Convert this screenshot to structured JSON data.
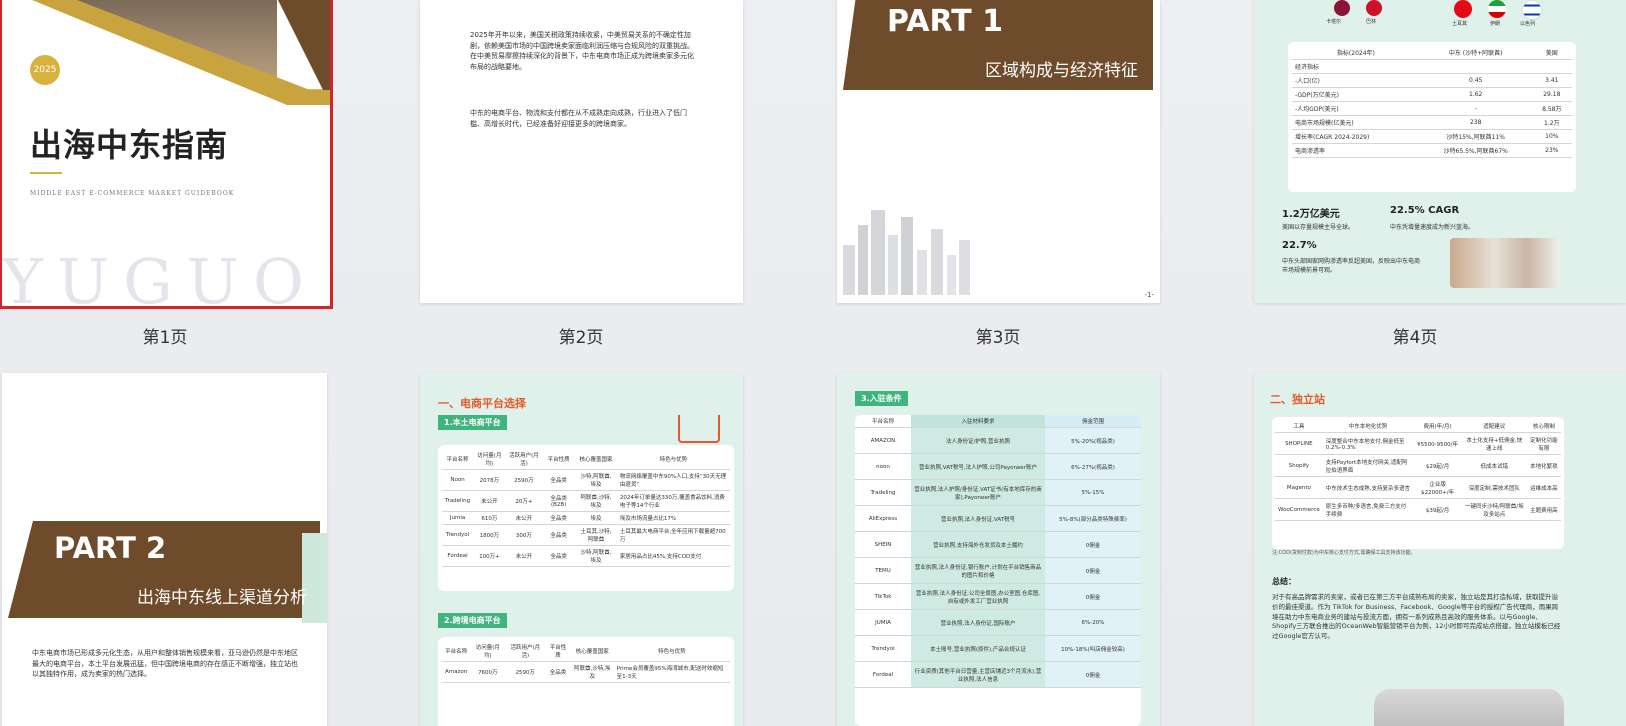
{
  "pages": [
    {
      "label": "第1页"
    },
    {
      "label": "第2页"
    },
    {
      "label": "第3页"
    },
    {
      "label": "第4页"
    }
  ],
  "p1": {
    "year": "2025",
    "title": "出海中东指南",
    "subtitle": "MIDDLE EAST E-COMMERCE MARKET GUIDEBOOK",
    "watermark": "YUGUO"
  },
  "p2": {
    "para1": "2025年开年以来，美国关税政策持续收紧，中美贸易关系的不确定性加剧，依赖美国市场的中国跨境卖家面临利润压缩与合规风险的双重挑战。在中美贸易摩擦持续深化的背景下，中东电商市场正成为跨境卖家多元化布局的战略要地。",
    "para2": "中东的电商平台、物流和支付都在从不成熟走向成熟，行业进入了低门槛、高增长时代，已经准备好迎接更多的跨境商家。"
  },
  "p3": {
    "part": "PART 1",
    "title": "区域构成与经济特征",
    "page_no": "-1-"
  },
  "p4": {
    "head": [
      "指标(2024年)",
      "中东 (沙特+阿联酋)",
      "美国"
    ],
    "rows": [
      [
        "经济指标",
        "",
        ""
      ],
      [
        "-人口(亿)",
        "0.45",
        "3.41"
      ],
      [
        "-GDP(万亿美元)",
        "1.62",
        "29.18"
      ],
      [
        "-人均GDP(美元)",
        "-",
        "8.58万"
      ],
      [
        "电商市场规模(亿美元)",
        "238",
        "1.2万"
      ],
      [
        "增长率(CAGR 2024-2029)",
        "沙特15%,阿联酋11%",
        "10%"
      ],
      [
        "电商渗透率",
        "沙特65.5%,阿联酋67%",
        "23%"
      ]
    ],
    "flags": [
      "卡塔尔",
      "巴林",
      "土耳其",
      "伊朗",
      "以色列"
    ],
    "stat1": "1.2万亿美元",
    "stat1_desc": "美国以存量规模主导全球。",
    "stat2": "22.5% CAGR",
    "stat2_desc": "中东凭增量速度成为新兴蓝海。",
    "stat3": "22.7%",
    "stat3_desc": "中东头部国家网购渗透率反超美国，反映出中东电商市场规模前景可观。"
  },
  "p5": {
    "part": "PART 2",
    "title": "出海中东线上渠道分析",
    "body": "中东电商市场已形成多元化生态，从用户和整体销售规模来看，亚马逊仍然是中东地区最大的电商平台，本土平台发展迅猛，但中国跨境电商的存在感正不断增强，独立站也以其独特作用，成为卖家的热门选择。"
  },
  "p6": {
    "section": "一、电商平台选择",
    "sub1": "1.本土电商平台",
    "head": [
      "平台名称",
      "访问量(月均)",
      "活跃用户(月活)",
      "平台性质",
      "核心覆盖国家",
      "特色与优势"
    ],
    "rows": [
      [
        "Noon",
        "2078万",
        "2590万",
        "全品类",
        "沙特,阿联酋,埃及",
        "物流网络覆盖中东90%人口,支持“30天无理由退货”"
      ],
      [
        "Tradeling",
        "未公开",
        "20万+",
        "全品类(B2B)",
        "阿联酋,沙特,埃及",
        "2024年订单量达330万,覆盖食品饮料,消费电子等14个行业"
      ],
      [
        "Jumia",
        "610万",
        "未公开",
        "全品类",
        "埃及",
        "埃及市场流量占比17%"
      ],
      [
        "Trendyol",
        "1800万",
        "300万",
        "全品类",
        "土耳其,沙特,阿联酋",
        "土耳其最大电商平台,全年应用下载量超700万"
      ],
      [
        "Fordeal",
        "100万+",
        "未公开",
        "全品类",
        "沙特,阿联酋,埃及",
        "家居用品占比45%,支持COD支付"
      ]
    ],
    "sub2": "2.跨境电商平台",
    "head2": [
      "平台名称",
      "访问量(月均)",
      "活跃用户(月活)",
      "平台性质",
      "核心覆盖国家",
      "特色与优势"
    ],
    "row2": [
      "Amazon",
      "7600万",
      "2590万",
      "全品类",
      "阿联酋,沙特,埃及",
      "Prime会员覆盖95%海湾城市,配送时效缩短至1-3天"
    ]
  },
  "p7": {
    "sub": "3.入驻条件",
    "head": [
      "平台名称",
      "入驻材料要求",
      "佣金范围"
    ],
    "rows": [
      [
        "AMAZON",
        "法人身份证/护照,营业执照",
        "5%-20%(视品类)"
      ],
      [
        "noon",
        "营业执照,VAT税号,法人护照,公司Payoneer账户",
        "6%-27%(视品类)"
      ],
      [
        "Tradeling",
        "营业执照,法人护照/身份证,VAT证书(有本地库存的商家),Payoneer账户",
        "5%-15%"
      ],
      [
        "AliExpress",
        "营业执照,法人身份证,VAT税号",
        "5%-8%(部分品类特殊费率)"
      ],
      [
        "SHEIN",
        "营业执照,支持海外仓发货及本土履约",
        "0佣金"
      ],
      [
        "TEMU",
        "营业执照,法人身份证,银行账户,计划在平台销售商品的图片和价格",
        "0佣金"
      ],
      [
        "TikTok",
        "营业执照,法人身份证,公司全景图,办公室图,仓库图,自有或外发工厂营业执照",
        "0佣金"
      ],
      [
        "JUMIA",
        "营业执照,法人身份证,国际账户",
        "6%-20%"
      ],
      [
        "Trendyol",
        "本土账号,营业执照(原件),产品合规认证",
        "10%-18%(叫店佣金较高)"
      ],
      [
        "Fordeal",
        "行业资质(其他平台日营量,主营店铺近3个月流水),营业执照,法人信息",
        "0佣金"
      ]
    ]
  },
  "p8": {
    "section": "二、独立站",
    "head": [
      "工具",
      "中东本地化优势",
      "费用(年/月)",
      "适配建议",
      "核心限制"
    ],
    "rows": [
      [
        "SHOPLINE",
        "深度整合中东本地支付,佣金低至0.2%-0.3%",
        "¥5500-9500/年",
        "本土化支持+低佣金,快速上线",
        "定制化功能有限"
      ],
      [
        "Shopify",
        "支持Payfort本地支付网关,适配阿拉伯语界面",
        "$29起/月",
        "低成本试错",
        "本地化繁琐"
      ],
      [
        "Magento",
        "中东技术生态成熟,支持复杂多语言",
        "企业版$22000+/年",
        "深度定制,需技术团队",
        "运维成本高"
      ],
      [
        "WooCommerce",
        "原生多币种/多语言,免费三方支付手续费",
        "$39起/月",
        "一键同步沙特/阿联酋/埃及多站点",
        "主题费用高"
      ]
    ],
    "note": "注:COD(货到付款)为中东核心支付方式,需确保工具支持该功能。",
    "summary_title": "总结：",
    "summary": "对于有高品牌需求的卖家，或者已在第三方平台成熟布局的卖家，独立站是其打造私域，获取提升溢价的最佳渠道。作为 TikTok for Business、Facebook、Google等平台的授权广告代理商，雨果跨境在助力中东电商业务的建站与投流方面，拥有一系列成熟且高效的服务体系。以与Google、Shopify三方联合推出的OceanWeb智能营销平台为例，12小时即可完成站点搭建，独立站模板已经过Google官方认可。"
  }
}
